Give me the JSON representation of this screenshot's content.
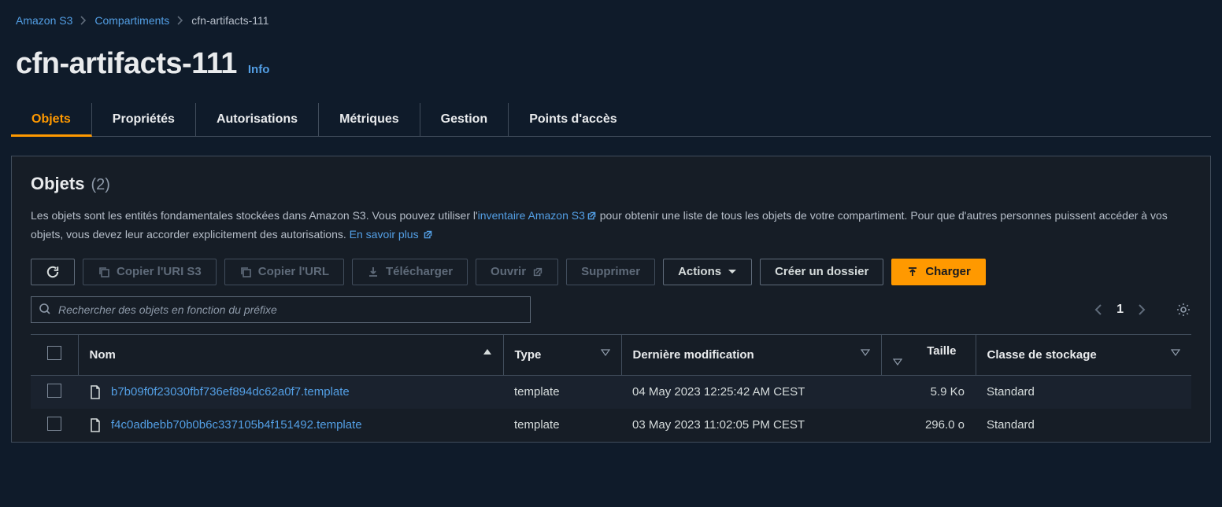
{
  "breadcrumb": {
    "root": "Amazon S3",
    "mid": "Compartiments",
    "current": "cfn-artifacts-111"
  },
  "title": "cfn-artifacts-111",
  "info_label": "Info",
  "tabs": {
    "objects": "Objets",
    "properties": "Propriétés",
    "permissions": "Autorisations",
    "metrics": "Métriques",
    "management": "Gestion",
    "access_points": "Points d'accès"
  },
  "panel": {
    "heading": "Objets",
    "count": "(2)",
    "desc_1": "Les objets sont les entités fondamentales stockées dans Amazon S3. Vous pouvez utiliser l'",
    "desc_link1": "inventaire Amazon S3",
    "desc_2": " pour obtenir une liste de tous les objets de votre compartiment. Pour que d'autres personnes puissent accéder à vos objets, vous devez leur accorder explicitement des autorisations. ",
    "desc_link2": "En savoir plus"
  },
  "toolbar": {
    "copy_uri": "Copier l'URI S3",
    "copy_url": "Copier l'URL",
    "download": "Télécharger",
    "open": "Ouvrir",
    "delete": "Supprimer",
    "actions": "Actions",
    "create_folder": "Créer un dossier",
    "upload": "Charger"
  },
  "search": {
    "placeholder": "Rechercher des objets en fonction du préfixe"
  },
  "pager": {
    "page": "1"
  },
  "columns": {
    "name": "Nom",
    "type": "Type",
    "modified": "Dernière modification",
    "size": "Taille",
    "storage": "Classe de stockage"
  },
  "rows": [
    {
      "name": "b7b09f0f23030fbf736ef894dc62a0f7.template",
      "type": "template",
      "modified": "04 May 2023 12:25:42 AM CEST",
      "size": "5.9 Ko",
      "storage": "Standard"
    },
    {
      "name": "f4c0adbebb70b0b6c337105b4f151492.template",
      "type": "template",
      "modified": "03 May 2023 11:02:05 PM CEST",
      "size": "296.0 o",
      "storage": "Standard"
    }
  ]
}
